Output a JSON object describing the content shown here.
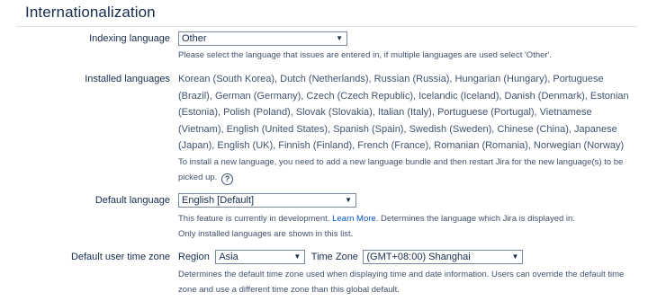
{
  "section": {
    "title": "Internationalization"
  },
  "indexing": {
    "label": "Indexing language",
    "selected": "Other",
    "help": "Please select the language that issues are entered in, if multiple languages are used select 'Other'."
  },
  "installed": {
    "label": "Installed languages",
    "list": "Korean (South Korea), Dutch (Netherlands), Russian (Russia), Hungarian (Hungary), Portuguese (Brazil), German (Germany), Czech (Czech Republic), Icelandic (Iceland), Danish (Denmark), Estonian (Estonia), Polish (Poland), Slovak (Slovakia), Italian (Italy), Portuguese (Portugal), Vietnamese (Vietnam), English (United States), Spanish (Spain), Swedish (Sweden), Chinese (China), Japanese (Japan), English (UK), Finnish (Finland), French (France), Romanian (Romania), Norwegian (Norway)",
    "note": "To install a new language, you need to add a new language bundle and then restart Jira for the new language(s) to be picked up.",
    "help_icon": "question-circle-icon"
  },
  "default_language": {
    "label": "Default language",
    "selected": "English [Default]",
    "desc_before": "This feature is currently in development.",
    "link": "Learn More",
    "desc_after": ". Determines the language which Jira is displayed in.",
    "desc_line2": "Only installed languages are shown in this list."
  },
  "timezone": {
    "label": "Default user time zone",
    "region_label": "Region",
    "region_selected": "Asia",
    "tz_label": "Time Zone",
    "tz_selected": "(GMT+08:00) Shanghai",
    "desc": "Determines the default time zone used when displaying time and date information. Users can override the default time zone and use a different time zone than this global default."
  },
  "colors": {
    "link": "#0052cc",
    "text": "#172b4d",
    "muted": "#42526e"
  }
}
